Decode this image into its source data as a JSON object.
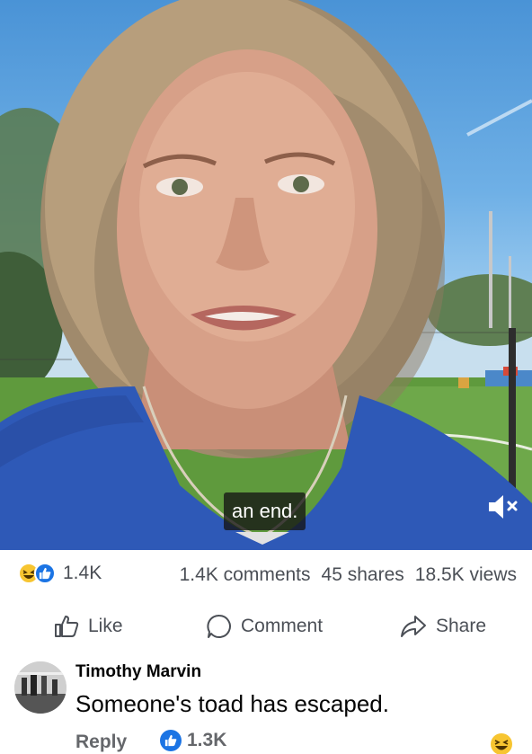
{
  "video": {
    "caption": "an end.",
    "mute_icon": "speaker-muted-icon"
  },
  "stats": {
    "reaction_icons": [
      "haha-reaction-icon",
      "like-reaction-icon"
    ],
    "reaction_count": "1.4K",
    "comments": "1.4K comments",
    "shares": "45 shares",
    "views": "18.5K views"
  },
  "actions": {
    "like_label": "Like",
    "comment_label": "Comment",
    "share_label": "Share"
  },
  "comment": {
    "author": "Timothy Marvin",
    "text": "Someone's toad has escaped.",
    "reply_label": "Reply",
    "like_count": "1.3K"
  },
  "colors": {
    "facebook_blue": "#1b74e4",
    "secondary_text": "#65676b",
    "haha_yellow": "#f7c531"
  }
}
